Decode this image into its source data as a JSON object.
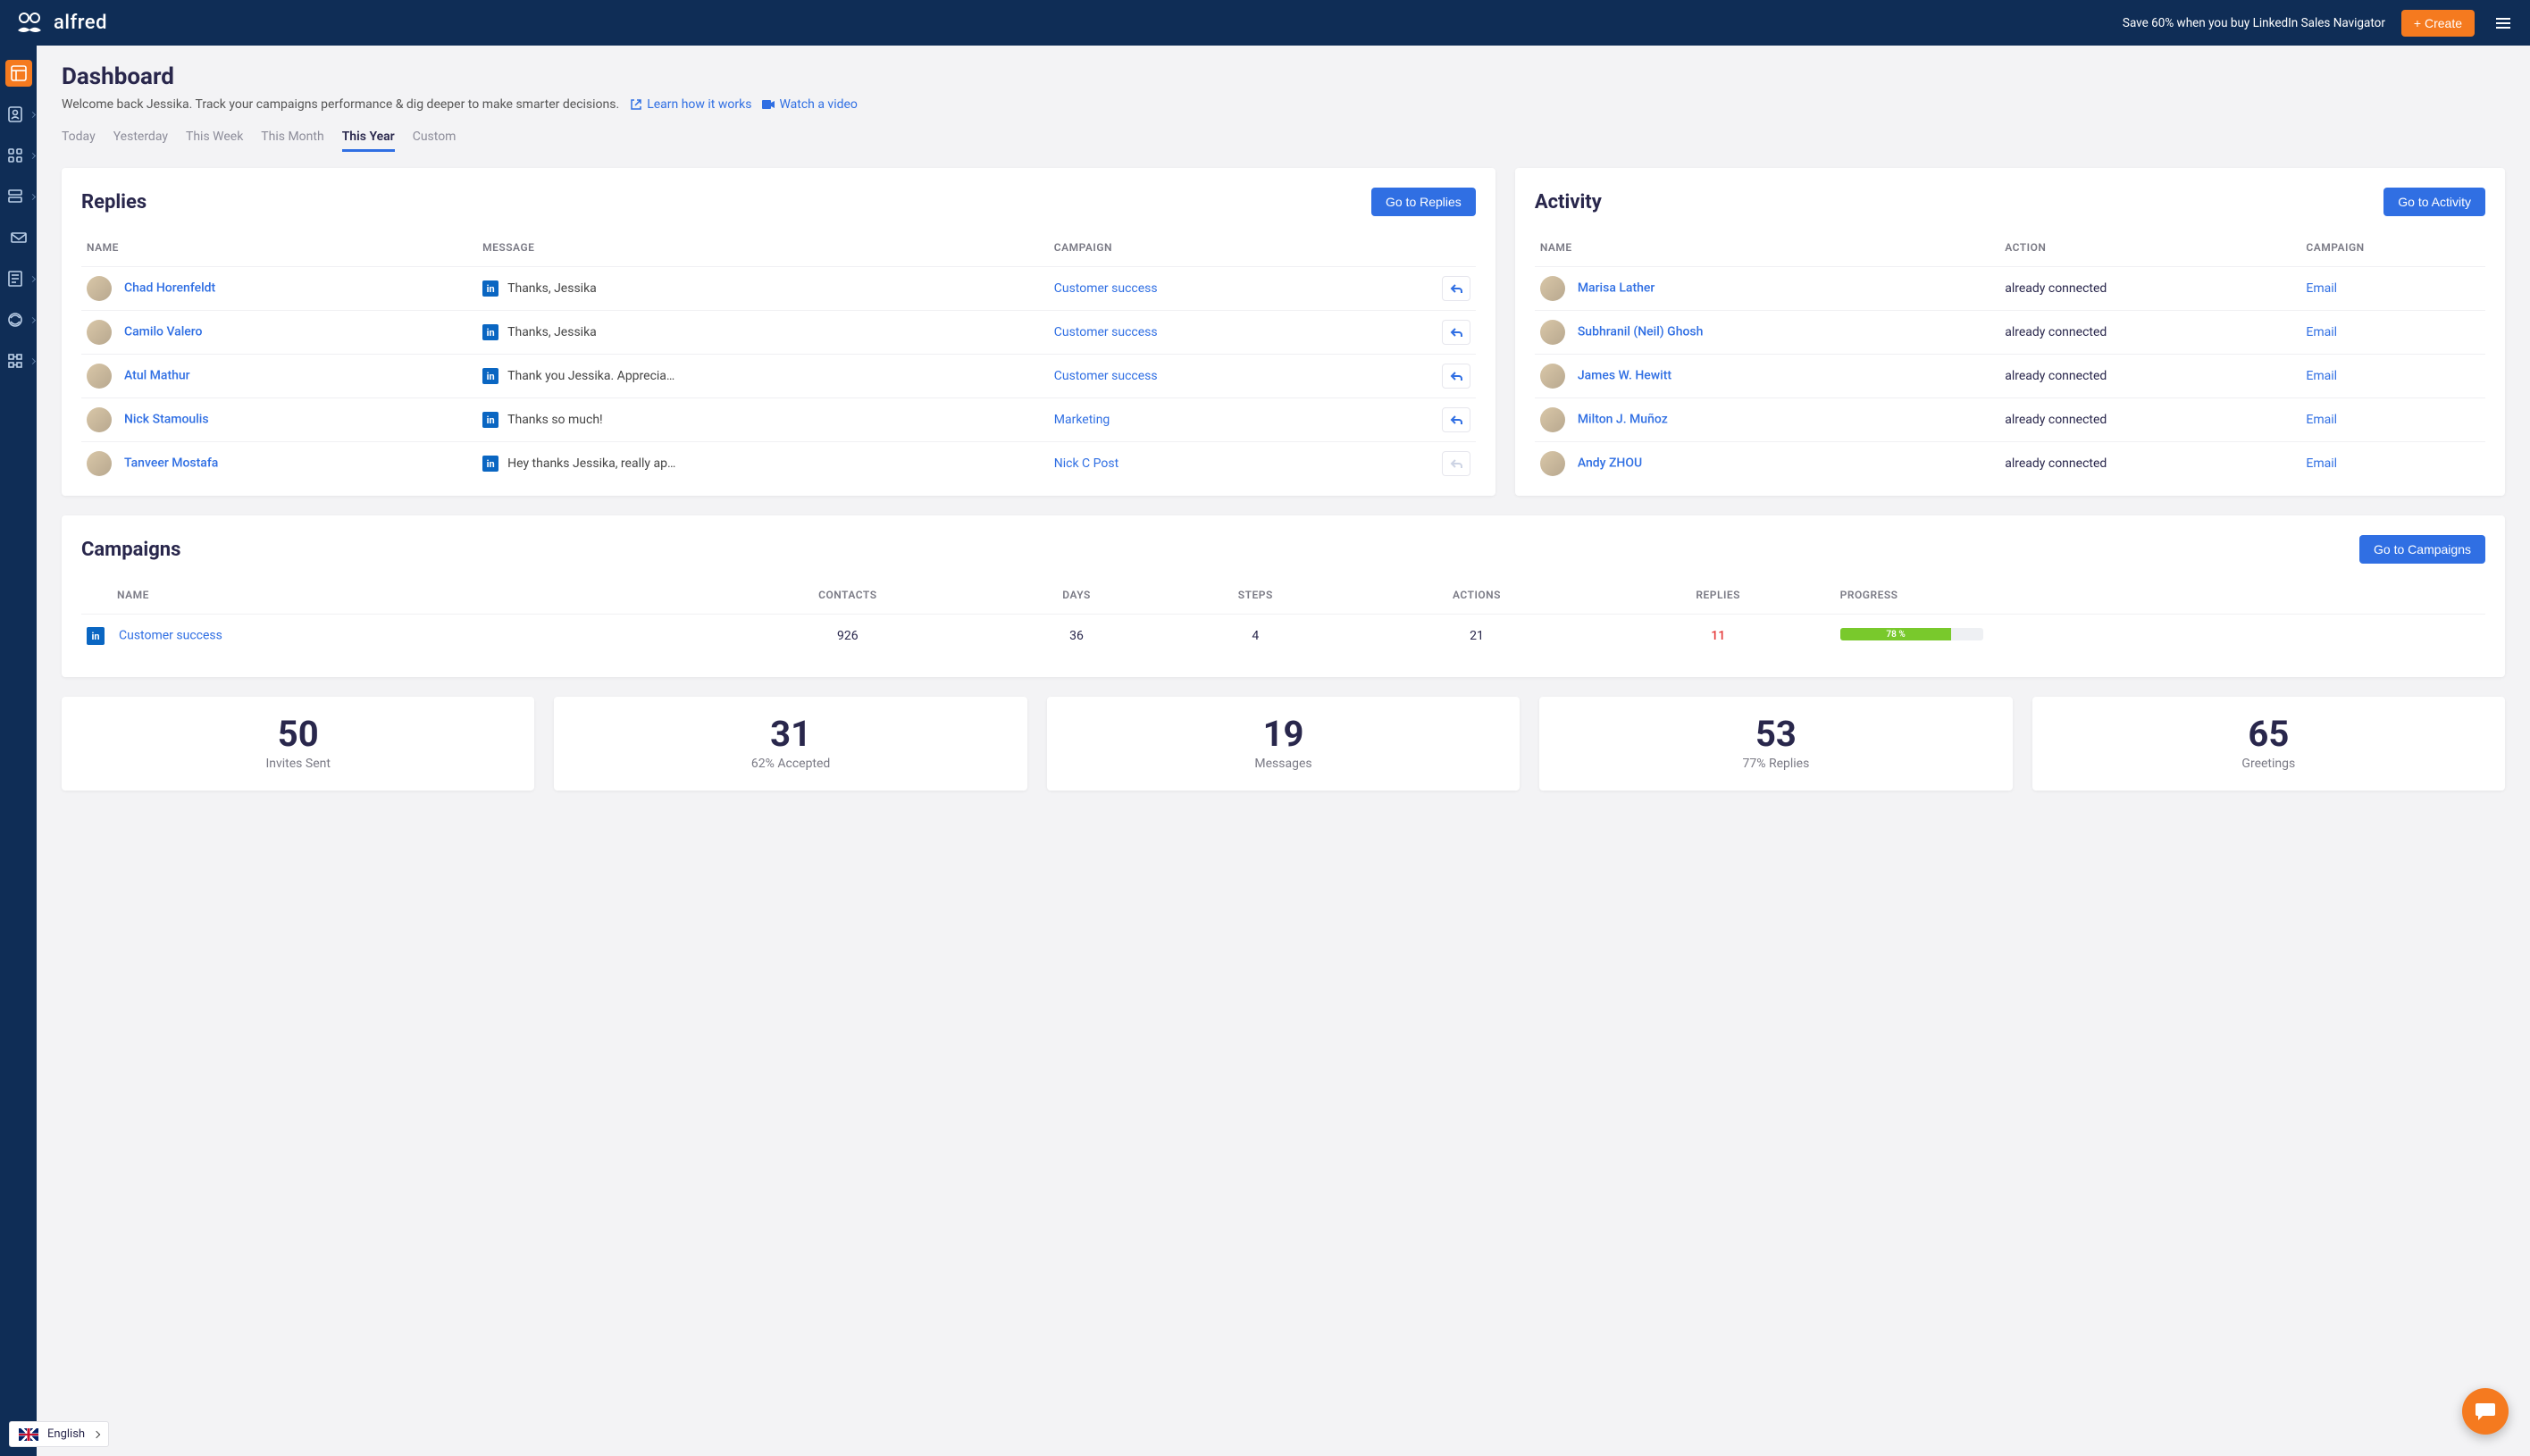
{
  "topbar": {
    "brand": "alfred",
    "promo": "Save 60% when you buy LinkedIn Sales Navigator",
    "create_label": "+ Create"
  },
  "sidebar": {
    "items": [
      "dashboard",
      "contacts",
      "grid",
      "cards",
      "inbox",
      "news",
      "headset",
      "qr"
    ]
  },
  "header": {
    "title": "Dashboard",
    "welcome": "Welcome back Jessika. Track your campaigns performance & dig deeper to make smarter decisions.",
    "learn_link": "Learn how it works",
    "watch_link": "Watch a video"
  },
  "tabs": {
    "items": [
      "Today",
      "Yesterday",
      "This Week",
      "This Month",
      "This Year",
      "Custom"
    ],
    "active_index": 4
  },
  "replies": {
    "title": "Replies",
    "cta": "Go to Replies",
    "headers": {
      "name": "NAME",
      "message": "MESSAGE",
      "campaign": "CAMPAIGN"
    },
    "rows": [
      {
        "name": "Chad Horenfeldt",
        "message": "Thanks, Jessika",
        "campaign": "Customer success",
        "muted": false
      },
      {
        "name": "Camilo Valero",
        "message": "Thanks, Jessika",
        "campaign": "Customer success",
        "muted": false
      },
      {
        "name": "Atul Mathur",
        "message": "Thank you Jessika. Appreciate the w…",
        "campaign": "Customer success",
        "muted": false
      },
      {
        "name": "Nick Stamoulis",
        "message": "Thanks so much!",
        "campaign": "Marketing",
        "muted": false
      },
      {
        "name": "Tanveer Mostafa",
        "message": "Hey thanks Jessika, really appreciat…",
        "campaign": "Nick C Post",
        "muted": true
      }
    ]
  },
  "activity": {
    "title": "Activity",
    "cta": "Go to Activity",
    "headers": {
      "name": "NAME",
      "action": "ACTION",
      "campaign": "CAMPAIGN"
    },
    "rows": [
      {
        "name": "Marisa Lather",
        "action": "already connected",
        "campaign": "Email"
      },
      {
        "name": "Subhranil (Neil) Ghosh",
        "action": "already connected",
        "campaign": "Email"
      },
      {
        "name": "James W. Hewitt",
        "action": "already connected",
        "campaign": "Email"
      },
      {
        "name": "Milton J. Muñoz",
        "action": "already connected",
        "campaign": "Email"
      },
      {
        "name": "Andy ZHOU",
        "action": "already connected",
        "campaign": "Email"
      }
    ]
  },
  "campaigns": {
    "title": "Campaigns",
    "cta": "Go to Campaigns",
    "headers": {
      "name": "NAME",
      "contacts": "CONTACTS",
      "days": "DAYS",
      "steps": "STEPS",
      "actions": "ACTIONS",
      "replies": "REPLIES",
      "progress": "PROGRESS"
    },
    "rows": [
      {
        "name": "Customer success",
        "contacts": "926",
        "days": "36",
        "steps": "4",
        "actions": "21",
        "replies": "11",
        "progress_pct": 78,
        "progress_label": "78 %"
      }
    ]
  },
  "stats": [
    {
      "value": "50",
      "label": "Invites Sent"
    },
    {
      "value": "31",
      "label": "62% Accepted"
    },
    {
      "value": "19",
      "label": "Messages"
    },
    {
      "value": "53",
      "label": "77% Replies"
    },
    {
      "value": "65",
      "label": "Greetings"
    }
  ],
  "lang": {
    "label": "English"
  }
}
